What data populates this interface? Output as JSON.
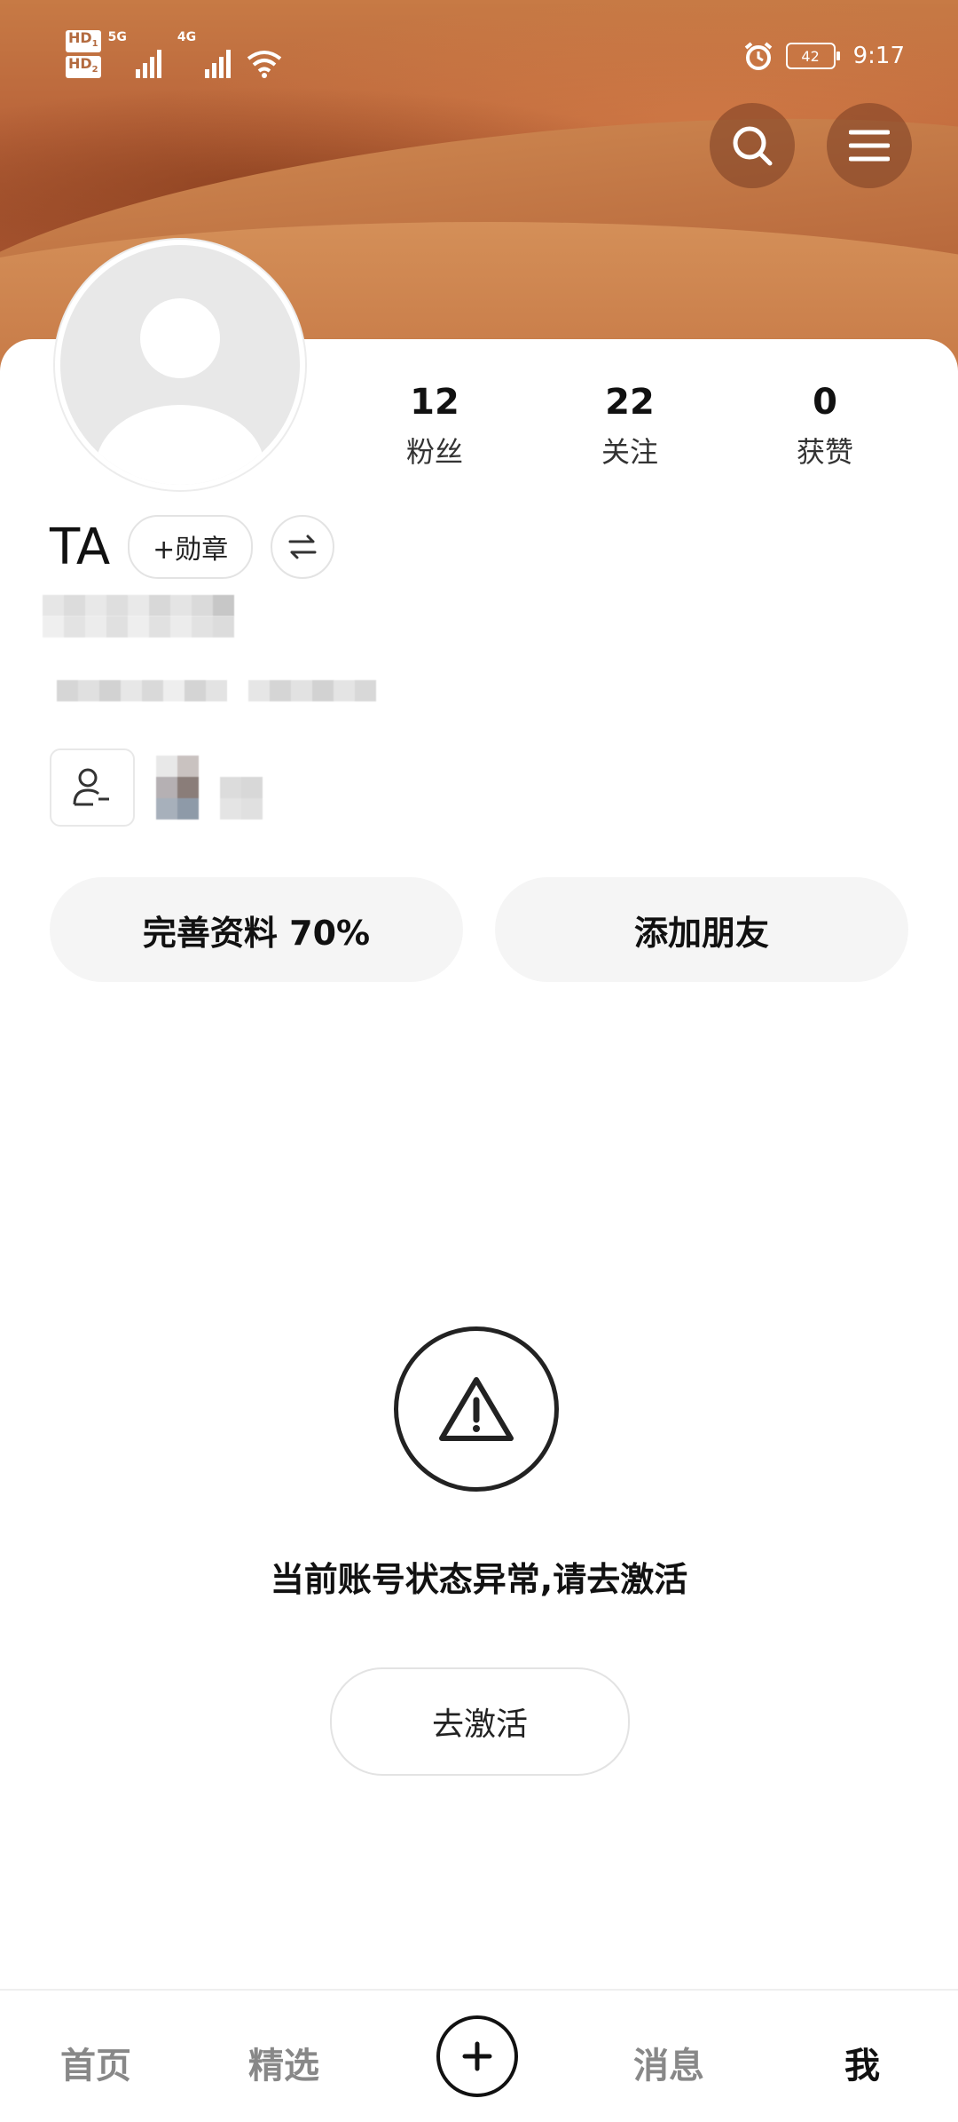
{
  "status_bar": {
    "hd1": "HD",
    "hd1_sub": "1",
    "hd2": "HD",
    "hd2_sub": "2",
    "net1": "5G",
    "net2": "4G",
    "battery": "42",
    "time": "9:17"
  },
  "header": {
    "search_icon": "search-icon",
    "menu_icon": "menu-icon"
  },
  "profile": {
    "name": "TA",
    "badge_label": "+勋章",
    "switch_icon": "switch-icon",
    "stats": [
      {
        "value": "12",
        "label": "粉丝"
      },
      {
        "value": "22",
        "label": "关注"
      },
      {
        "value": "0",
        "label": "获赞"
      }
    ]
  },
  "actions": {
    "complete_profile": "完善资料 70%",
    "add_friend": "添加朋友"
  },
  "notice": {
    "message": "当前账号状态异常,请去激活",
    "activate_label": "去激活"
  },
  "tabbar": {
    "home": "首页",
    "featured": "精选",
    "messages": "消息",
    "me": "我"
  }
}
